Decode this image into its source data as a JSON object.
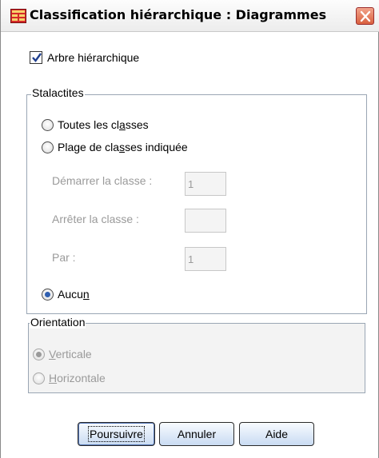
{
  "window": {
    "title": "Classification hiérarchique : Diagrammes",
    "accent_color": "#d62a2a"
  },
  "dendrogram": {
    "label": "Arbre hiérarchique",
    "checked": true
  },
  "icicle": {
    "group_title": "Stalactites",
    "options": {
      "all": {
        "pre": "Toutes les cl",
        "ul": "a",
        "post": "sses",
        "selected": false
      },
      "range": {
        "pre": "Plage de cla",
        "ul": "s",
        "post": "ses indiquée",
        "selected": false
      },
      "none": {
        "pre": "Aucu",
        "ul": "n",
        "post": "",
        "selected": true
      }
    },
    "start_label": "Démarrer la classe :",
    "start_value": "1",
    "stop_label": "Arrêter la classe :",
    "stop_value": "",
    "by_label": "Par :",
    "by_value": "1"
  },
  "orientation": {
    "group_title": "Orientation",
    "vertical": {
      "pre": "",
      "ul": "V",
      "post": "erticale",
      "selected": true
    },
    "horizontal": {
      "pre": "",
      "ul": "H",
      "post": "orizontale",
      "selected": false
    }
  },
  "buttons": {
    "continue": "Poursuivre",
    "cancel": "Annuler",
    "help": "Aide"
  }
}
